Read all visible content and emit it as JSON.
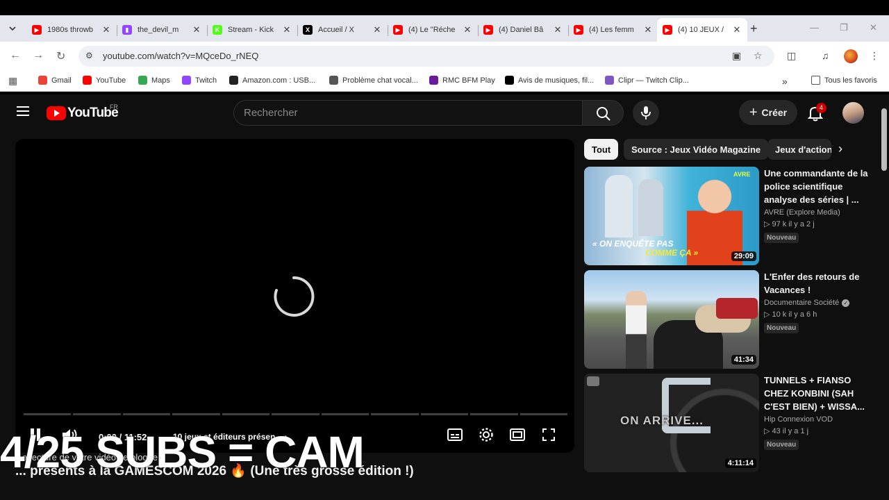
{
  "browser": {
    "tabs": [
      {
        "title": "1980s throwb",
        "favicon": "youtube",
        "color": "#ff0000"
      },
      {
        "title": "the_devil_m",
        "favicon": "twitch",
        "color": "#9146ff"
      },
      {
        "title": "Stream - Kick",
        "favicon": "kick",
        "color": "#53fc18"
      },
      {
        "title": "Accueil / X",
        "favicon": "x",
        "color": "#000000"
      },
      {
        "title": "(4) Le \"Réche",
        "favicon": "youtube",
        "color": "#ff0000"
      },
      {
        "title": "(4) Daniel Bâ",
        "favicon": "youtube",
        "color": "#ff0000"
      },
      {
        "title": "(4) Les femm",
        "favicon": "youtube",
        "color": "#ff0000"
      },
      {
        "title": "(4) 10 JEUX /",
        "favicon": "youtube",
        "color": "#ff0000",
        "active": true
      }
    ],
    "url": "youtube.com/watch?v=MQceDo_rNEQ",
    "bookmarks": [
      {
        "label": "Gmail",
        "icon": "gmail-icon"
      },
      {
        "label": "YouTube",
        "icon": "youtube-icon"
      },
      {
        "label": "Maps",
        "icon": "maps-icon"
      },
      {
        "label": "Twitch",
        "icon": "twitch-icon"
      },
      {
        "label": "Amazon.com : USB...",
        "icon": "amazon-icon"
      },
      {
        "label": "Problème chat vocal...",
        "icon": "globe-icon"
      },
      {
        "label": "RMC BFM Play",
        "icon": "rmc-icon"
      },
      {
        "label": "Avis de musiques, fil...",
        "icon": "x-icon"
      },
      {
        "label": "Clipr — Twitch Clip...",
        "icon": "clipr-icon"
      }
    ],
    "all_bookmarks": "Tous les favoris"
  },
  "youtube": {
    "logo_word": "YouTube",
    "country": "FR",
    "search_placeholder": "Rechercher",
    "create_label": "Créer",
    "notif_count": "4",
    "player": {
      "time": "0:00 / 11:52",
      "chapter": "10 jeux et éditeurs présen..."
    },
    "autoplay_msg": "a lecture de votre vidéo se bloque ?",
    "video_title": "... présents à la GAMESCOM 2026 🔥 (Une très grosse édition !)",
    "overlay": "4/25 SUBS = CAM",
    "chips": [
      "Tout",
      "Source : Jeux Vidéo Magazine",
      "Jeux d'action"
    ],
    "recommendations": [
      {
        "title": "Une commandante de la police scientifique analyse des séries | ...",
        "channel": "AVRE (Explore Media)",
        "stats": "▷ 97 k   il y a 2 j",
        "badge": "Nouveau",
        "duration": "29:09",
        "thumb_caption1": "« ON ENQUÊTE PAS",
        "thumb_caption2": "COMME ÇA »",
        "thumb_tag": "AVRE",
        "verified": false
      },
      {
        "title": "L'Enfer des retours de Vacances !",
        "channel": "Documentaire Société",
        "stats": "▷ 10 k   il y a 6 h",
        "badge": "Nouveau",
        "duration": "41:34",
        "verified": true
      },
      {
        "title": "TUNNELS + FIANSO CHEZ KONBINI (SAH C'EST BIEN) + WISSA...",
        "channel": "Hip Connexion VOD",
        "stats": "▷ 43   il y a 1 j",
        "badge": "Nouveau",
        "duration": "4:11:14",
        "thumb_caption1": "ON ARRIVE...",
        "verified": false
      }
    ]
  }
}
